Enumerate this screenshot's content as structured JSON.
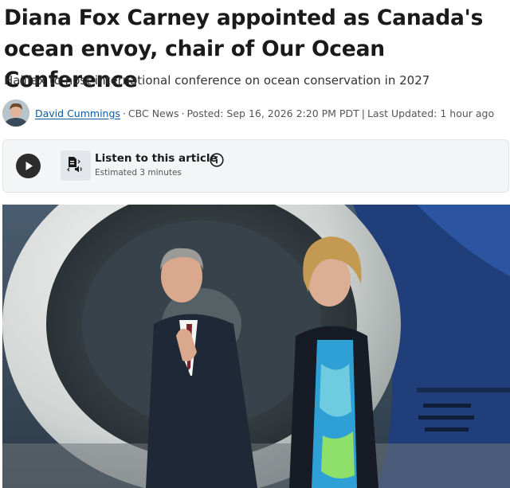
{
  "headline": "Diana Fox Carney appointed as Canada's ocean envoy, chair of Our Ocean Conference",
  "deck": "Halifax to host international conference on ocean conservation in 2027",
  "byline": {
    "author": "David Cummings",
    "separator": "·",
    "outlet": "CBC News",
    "posted": "Posted: Sep 16, 2026 2:20 PM PDT",
    "divider": "|",
    "updated": "Last Updated: 1 hour ago"
  },
  "audio": {
    "title": "Listen to this article",
    "estimate": "Estimated 3 minutes"
  },
  "icons": {
    "play": "play-icon",
    "audio": "document-audio-icon",
    "info": "info-icon"
  },
  "colors": {
    "author_link": "#0b5aa2",
    "panel_bg": "#f3f5f7",
    "play_button": "#2c2c2c"
  }
}
